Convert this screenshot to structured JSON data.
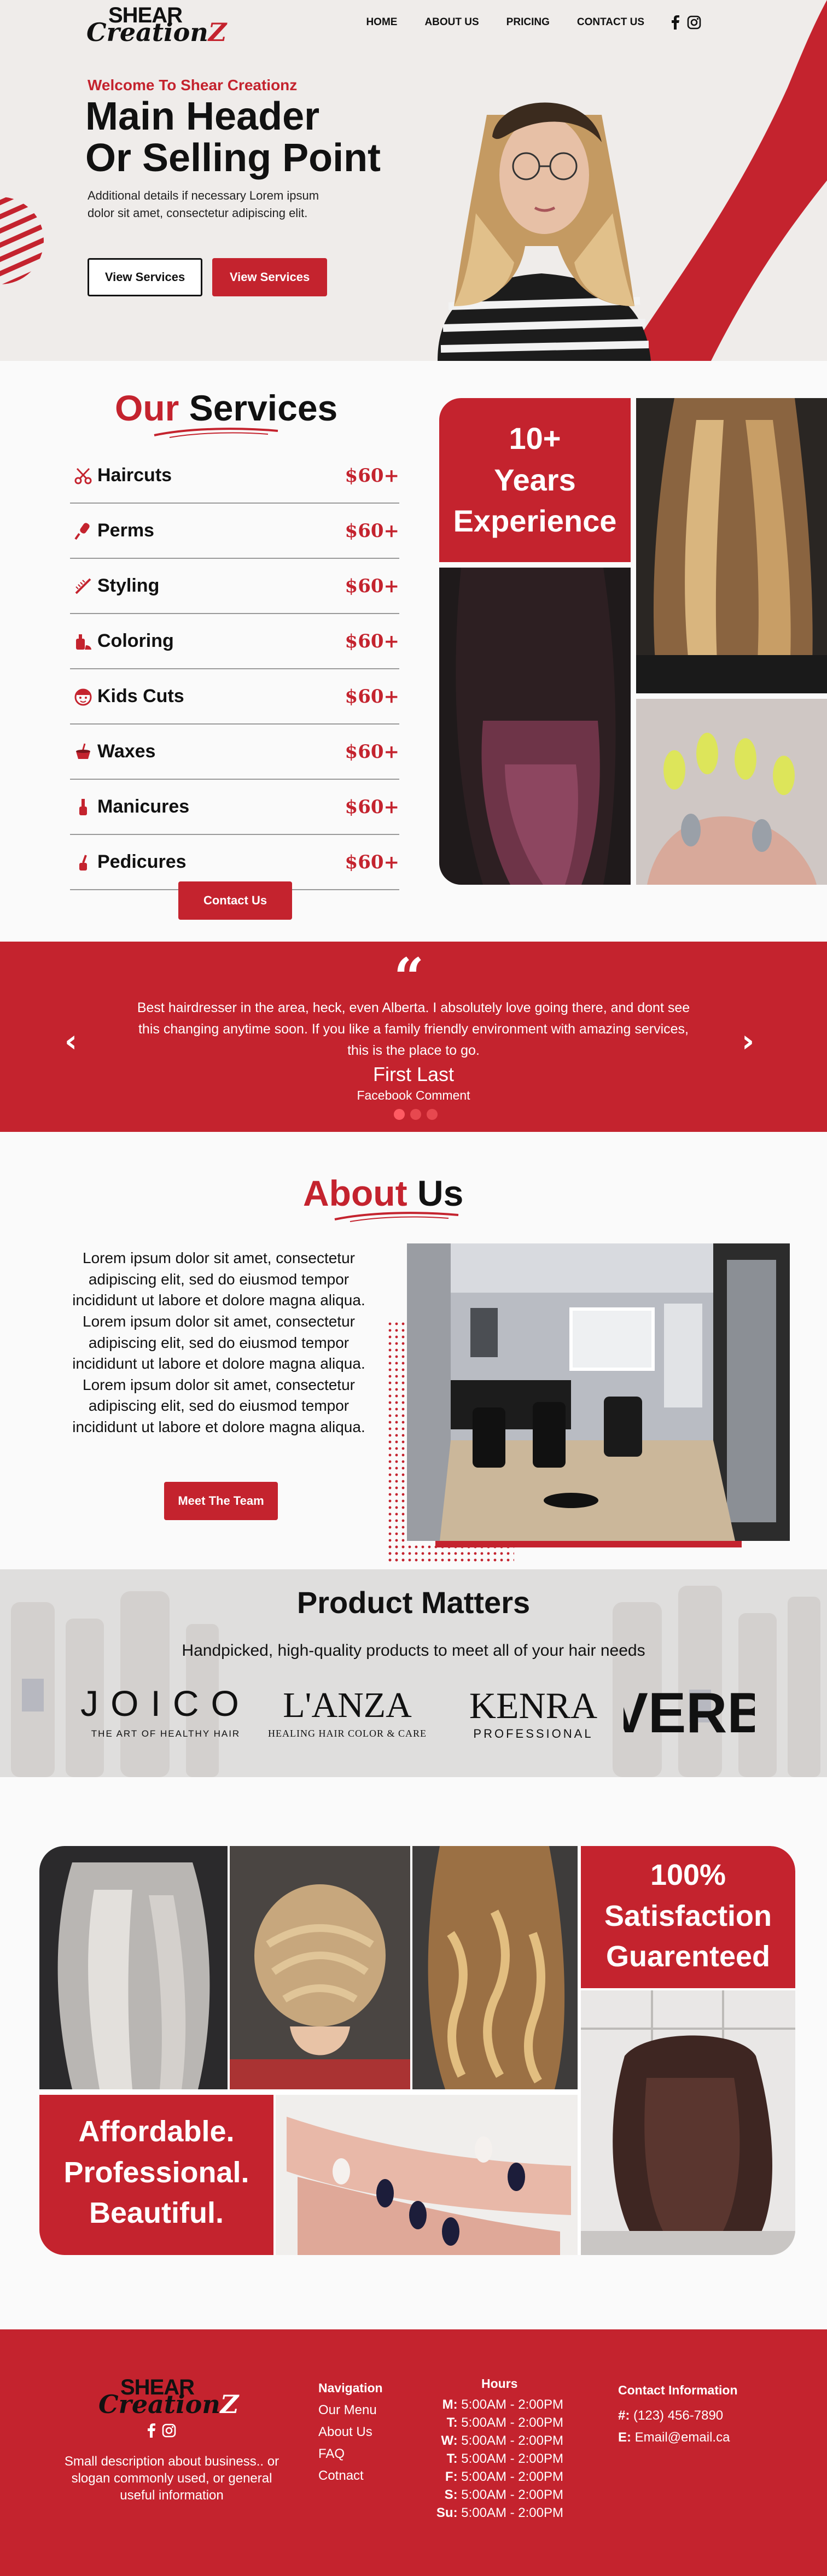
{
  "brand": {
    "logo_top": "SHEAR",
    "logo_script": "Creation",
    "logo_z": "Z"
  },
  "nav": {
    "items": [
      "HOME",
      "ABOUT US",
      "PRICING",
      "CONTACT US"
    ],
    "social": [
      "facebook-icon",
      "instagram-icon"
    ]
  },
  "hero": {
    "welcome": "Welcome To Shear Creationz",
    "headline_1": "Main Header",
    "headline_2": "Or Selling Point",
    "description": "Additional details if necessary Lorem ipsum dolor sit amet, consectetur adipiscing elit.",
    "button_outline": "View Services",
    "button_filled": "View Services"
  },
  "services": {
    "title_accent": "Our",
    "title_rest": "Services",
    "items": [
      {
        "name": "Haircuts",
        "price": "$60+",
        "icon": "scissors-icon"
      },
      {
        "name": "Perms",
        "price": "$60+",
        "icon": "curling-iron-icon"
      },
      {
        "name": "Styling",
        "price": "$60+",
        "icon": "comb-icon"
      },
      {
        "name": "Coloring",
        "price": "$60+",
        "icon": "dye-bottle-icon"
      },
      {
        "name": "Kids Cuts",
        "price": "$60+",
        "icon": "child-face-icon"
      },
      {
        "name": "Waxes",
        "price": "$60+",
        "icon": "wax-pot-icon"
      },
      {
        "name": "Manicures",
        "price": "$60+",
        "icon": "nail-polish-icon"
      },
      {
        "name": "Pedicures",
        "price": "$60+",
        "icon": "nail-brush-icon"
      }
    ],
    "contact_button": "Contact Us",
    "experience_1": "10+",
    "experience_2": "Years",
    "experience_3": "Experience"
  },
  "testimonial": {
    "quote": "Best hairdresser in the area, heck, even Alberta. I absolutely love going there, and dont see this changing anytime soon. If you like a family friendly environment with amazing services, this is the place to go.",
    "name": "First Last",
    "source": "Facebook Comment",
    "slides": 3,
    "active_slide": 1
  },
  "about": {
    "title_accent": "About",
    "title_rest": "Us",
    "body": "Lorem ipsum dolor sit amet, consectetur adipiscing elit, sed do eiusmod tempor incididunt ut labore et dolore magna aliqua. Lorem ipsum dolor sit amet, consectetur adipiscing elit, sed do eiusmod tempor incididunt ut labore et dolore magna aliqua.  Lorem ipsum dolor sit amet, consectetur adipiscing elit, sed do eiusmod tempor incididunt ut labore et dolore magna aliqua.",
    "button": "Meet The Team"
  },
  "products": {
    "title": "Product Matters",
    "subtitle": "Handpicked, high-quality products to meet all of your hair needs",
    "brands": [
      {
        "name": "JOICO",
        "tagline": "THE ART OF HEALTHY HAIR"
      },
      {
        "name": "L'ANZA",
        "tagline": "HEALING HAIR COLOR & CARE"
      },
      {
        "name": "KENRA",
        "tagline": "PROFESSIONAL"
      },
      {
        "name": "VERB",
        "tagline": ""
      }
    ]
  },
  "gallery": {
    "satisfaction_1": "100%",
    "satisfaction_2": "Satisfaction",
    "satisfaction_3": "Guarenteed",
    "tag_1": "Affordable.",
    "tag_2": "Professional.",
    "tag_3": "Beautiful."
  },
  "footer": {
    "description": "Small description about business.. or slogan commonly used, or general useful information",
    "nav_heading": "Navigation",
    "nav_links": [
      "Our Menu",
      "About Us",
      "FAQ",
      "Cotnact"
    ],
    "hours_heading": "Hours",
    "hours": [
      {
        "day": "M:",
        "time": "5:00AM - 2:00PM"
      },
      {
        "day": "T:",
        "time": "5:00AM - 2:00PM"
      },
      {
        "day": "W:",
        "time": "5:00AM - 2:00PM"
      },
      {
        "day": "T:",
        "time": "5:00AM - 2:00PM"
      },
      {
        "day": "F:",
        "time": "5:00AM - 2:00PM"
      },
      {
        "day": "S:",
        "time": "5:00AM - 2:00PM"
      },
      {
        "day": "Su:",
        "time": "5:00AM - 2:00PM"
      }
    ],
    "contact_heading": "Contact Information",
    "phone_label": "#:",
    "phone": "(123) 456-7890",
    "email_label": "E:",
    "email": "Email@email.ca"
  },
  "colors": {
    "accent": "#c4232e",
    "page_bg": "#fafafa",
    "hero_bg": "#efecea",
    "text": "#111111"
  }
}
